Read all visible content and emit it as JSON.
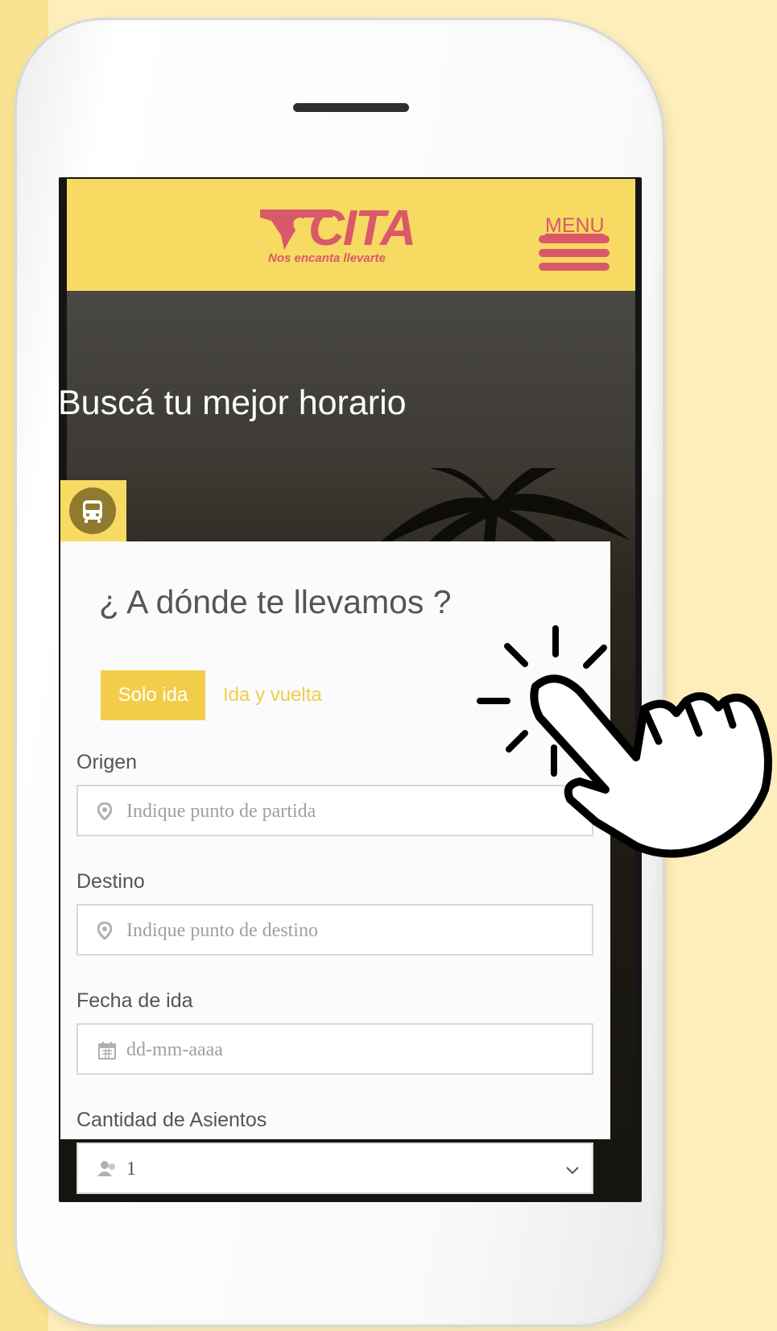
{
  "header": {
    "brand": "CITA",
    "slogan": "Nos encanta llevarte",
    "menu_label": "MENU"
  },
  "hero": {
    "title": "Buscá tu mejor horario"
  },
  "form": {
    "title": "¿ A dónde te llevamos ?",
    "tabs": [
      {
        "label": "Solo ida",
        "active": true
      },
      {
        "label": "Ida y vuelta",
        "active": false
      }
    ],
    "origin": {
      "label": "Origen",
      "placeholder": "Indique punto de partida",
      "icon": "map-marker-icon"
    },
    "destination": {
      "label": "Destino",
      "placeholder": "Indique punto de destino",
      "icon": "map-marker-icon"
    },
    "date": {
      "label": "Fecha de ida",
      "placeholder": "dd-mm-aaaa",
      "icon": "calendar-icon"
    },
    "seats": {
      "label": "Cantidad de Asientos",
      "value": "1",
      "icon": "users-icon"
    }
  },
  "colors": {
    "background": "#fdeebb",
    "header_yellow": "#f7da61",
    "brand_red": "#d9596a",
    "accent_yellow": "#f3cd4a"
  }
}
